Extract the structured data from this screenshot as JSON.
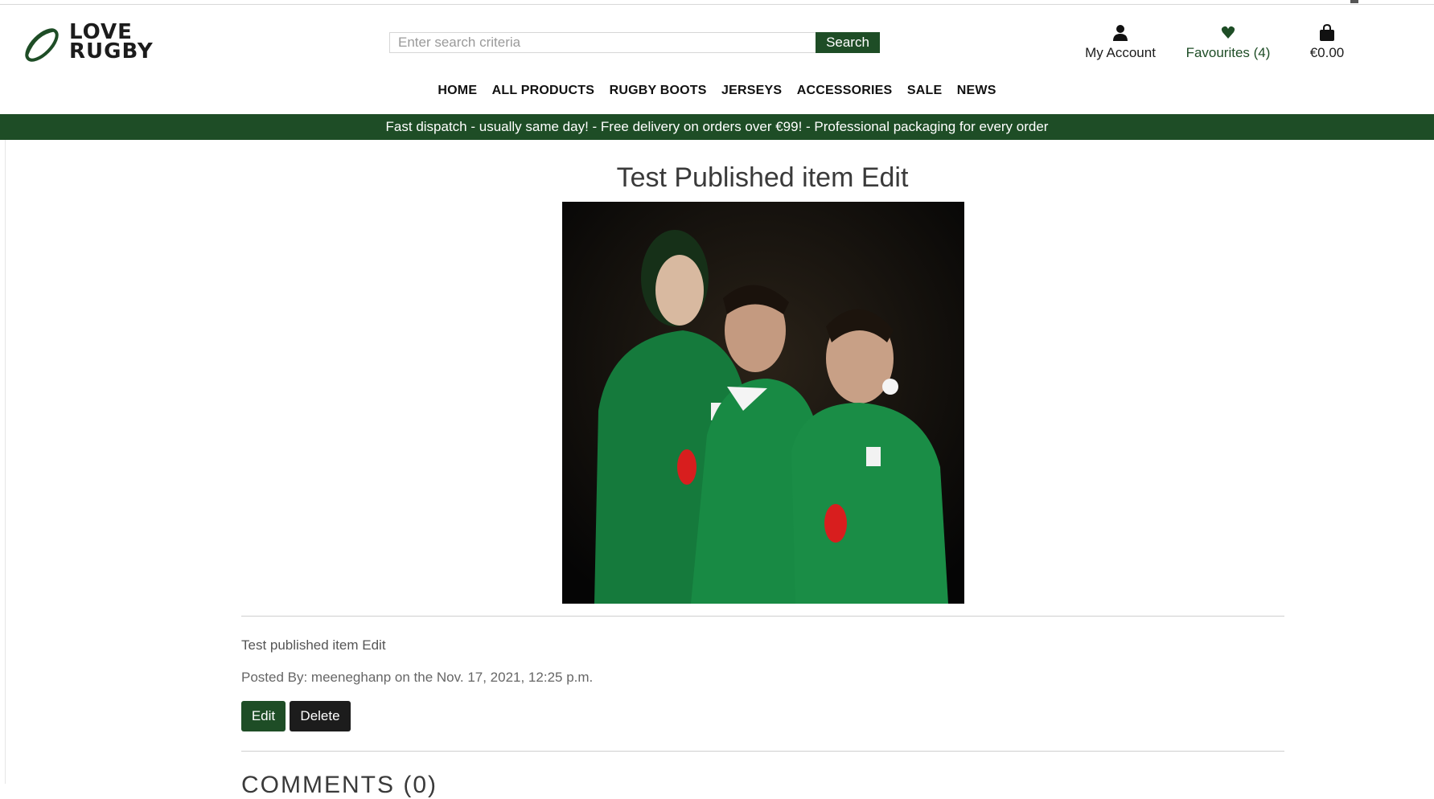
{
  "header": {
    "logo_line1": "LOVE",
    "logo_line2": "RUGBY",
    "search": {
      "placeholder": "Enter search criteria",
      "value": "",
      "button_label": "Search"
    },
    "account_label": "My Account",
    "favourites_label": "Favourites (4)",
    "cart_total": "€0.00"
  },
  "nav": {
    "items": [
      "HOME",
      "ALL PRODUCTS",
      "RUGBY BOOTS",
      "JERSEYS",
      "ACCESSORIES",
      "SALE",
      "NEWS"
    ]
  },
  "banner": {
    "text": "Fast dispatch - usually same day! - Free delivery on orders over €99! - Professional packaging for every order"
  },
  "post": {
    "title": "Test Published item Edit",
    "body": "Test published item Edit",
    "meta": "Posted By: meeneghanp on the Nov. 17, 2021, 12:25 p.m.",
    "edit_label": "Edit",
    "delete_label": "Delete",
    "comments_heading": "COMMENTS (0)"
  },
  "icons": {
    "logo": "rugby-ball-icon",
    "account": "user-icon",
    "favourites": "heart-icon",
    "cart": "shopping-bag-icon"
  },
  "colors": {
    "brand_green": "#1e4d26",
    "dark_button": "#1c1c1c"
  }
}
